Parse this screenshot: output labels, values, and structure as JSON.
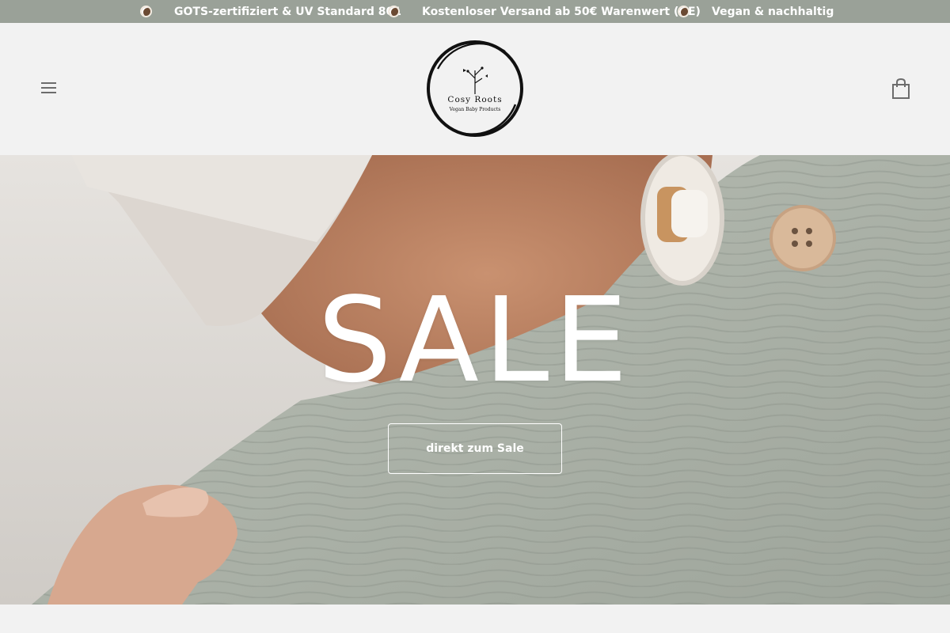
{
  "announcement": {
    "items": [
      {
        "icon": "coconut-icon",
        "text": "GOTS-zertifiziert & UV Standard 801"
      },
      {
        "icon": "coconut-icon",
        "text": "Kostenloser Versand ab 50€ Warenwert (DE)"
      },
      {
        "icon": "coconut-icon",
        "text": "Vegan & nachhaltig"
      }
    ],
    "background": "#9aa198"
  },
  "header": {
    "menu_icon": "hamburger-menu-icon",
    "logo": {
      "title": "Cosy Roots",
      "subtitle": "Vegan Baby Products"
    },
    "cart_icon": "shopping-bag-icon"
  },
  "hero": {
    "title": "SALE",
    "button_label": "direkt zum Sale"
  }
}
